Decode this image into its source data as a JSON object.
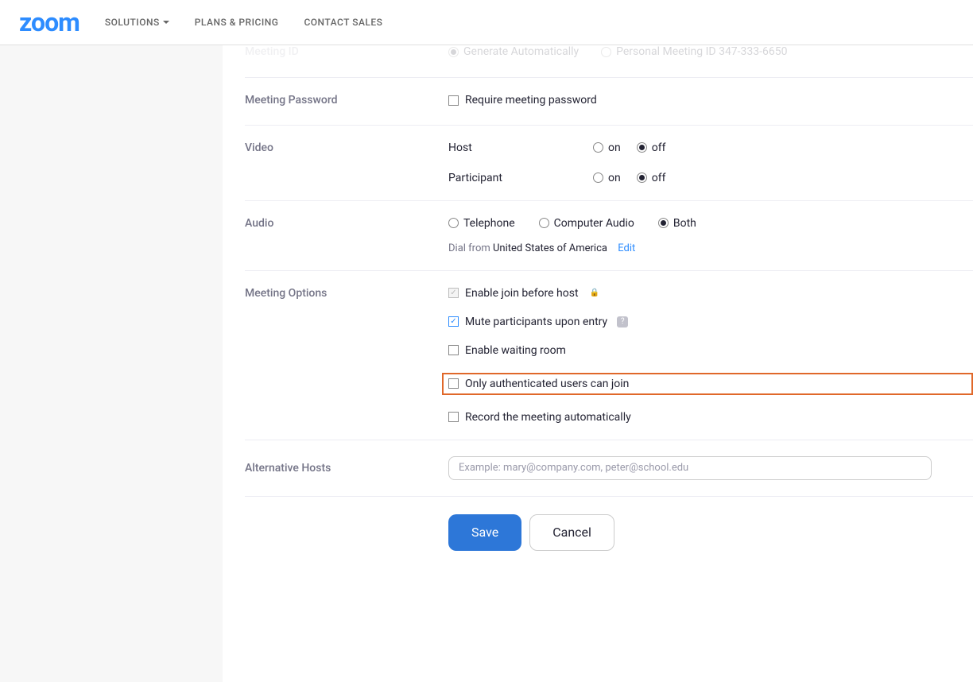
{
  "topbar": {
    "logo_text": "zoom",
    "nav": {
      "solutions": "SOLUTIONS",
      "plans": "PLANS & PRICING",
      "contact": "CONTACT SALES"
    }
  },
  "meeting_id": {
    "label": "Meeting ID",
    "auto": "Generate Automatically",
    "personal": "Personal Meeting ID 347-333-6650"
  },
  "password": {
    "label": "Meeting Password",
    "checkbox": "Require meeting password"
  },
  "video": {
    "label": "Video",
    "host": "Host",
    "participant": "Participant",
    "on": "on",
    "off": "off"
  },
  "audio": {
    "label": "Audio",
    "telephone": "Telephone",
    "computer": "Computer Audio",
    "both": "Both",
    "dial_prefix": "Dial from ",
    "country": "United States of America",
    "edit": "Edit"
  },
  "options": {
    "label": "Meeting Options",
    "join_before": "Enable join before host",
    "mute": "Mute participants upon entry",
    "waiting": "Enable waiting room",
    "auth": "Only authenticated users can join",
    "record": "Record the meeting automatically"
  },
  "alt_hosts": {
    "label": "Alternative Hosts",
    "placeholder": "Example: mary@company.com, peter@school.edu"
  },
  "buttons": {
    "save": "Save",
    "cancel": "Cancel"
  }
}
